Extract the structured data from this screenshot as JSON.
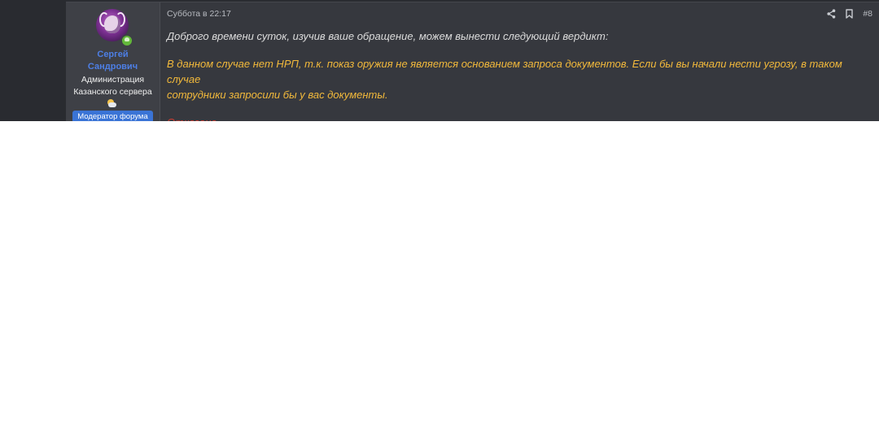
{
  "user": {
    "name_line1": "Сергей",
    "name_line2": "Сандрович",
    "title_line1": "Администрация",
    "title_line2": "Казанского сервера",
    "badge": "Модератор форума",
    "avatar_icon": "purple-avatar-icon",
    "status_icon": "online-status-icon",
    "weather_icon": "sun-cloud-icon",
    "username_color": "#4d7fe6",
    "badge_color": "#3a74d6"
  },
  "post": {
    "timestamp": "Суббота в 22:17",
    "number": "#8",
    "share_icon": "share-icon",
    "bookmark_icon": "bookmark-icon",
    "intro": "Доброго времени суток, изучив ваше обращение, можем вынести следующий вердикт:",
    "verdict_line1": "В данном случае нет НРП, т.к. показ оружия не является основанием запроса документов. Если бы вы начали нести угрозу, в таком случае",
    "verdict_line2": "сотрудники запросили бы у вас документы.",
    "result": "Отказано",
    "intro_color": "#dcdcdc",
    "verdict_color": "#f2b93b",
    "result_color": "#d23b30"
  }
}
